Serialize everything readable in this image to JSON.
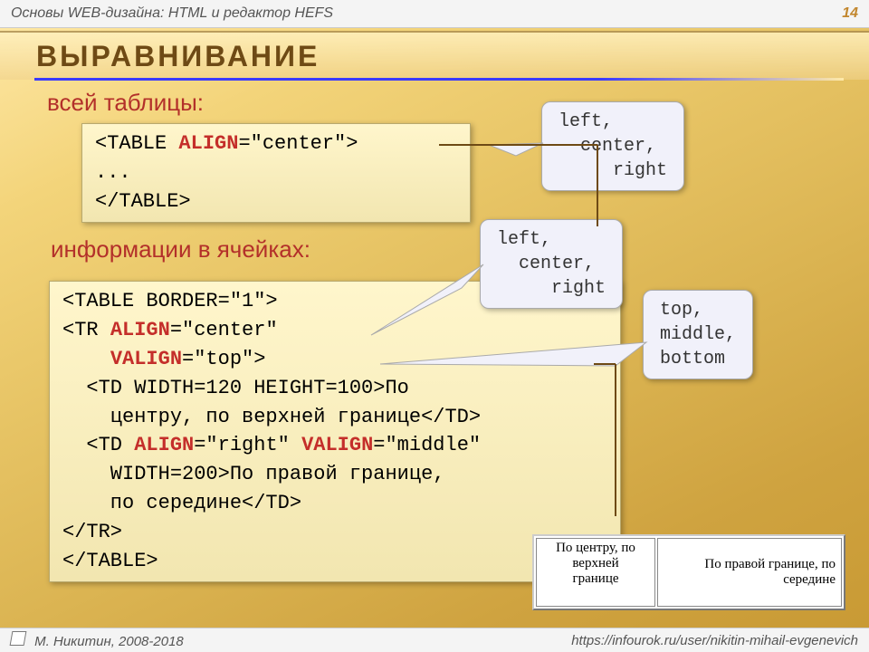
{
  "header": {
    "subject": "Основы WEB-дизайна: HTML и редактор HEFS",
    "page": "14"
  },
  "title": "Выравнивание",
  "sub1": "всей таблицы:",
  "sub2": "информации в ячейках:",
  "code1": {
    "l1a": "<TABLE ",
    "l1b": "ALIGN",
    "l1c": "=\"center\">",
    "l2": "...",
    "l3": "</TABLE>"
  },
  "code2": {
    "l1": "<TABLE BORDER=\"1\">",
    "l2a": "<TR ",
    "l2b": "ALIGN",
    "l2c": "=\"center\"",
    "l3a": "    ",
    "l3b": "VALIGN",
    "l3c": "=\"top\">",
    "l4": "  <TD WIDTH=120 HEIGHT=100>По",
    "l5": "    центру, по верхней границе</TD>",
    "l6a": "  <TD ",
    "l6b": "ALIGN",
    "l6c": "=\"right\" ",
    "l6d": "VALIGN",
    "l6e": "=\"middle\"",
    "l7": "    WIDTH=200>По правой границе,",
    "l8": "    по середине</TD>",
    "l9": "</TR>",
    "l10": "</TABLE>"
  },
  "callout1": "left,\n  center,\n     right",
  "callout2": "left,\n  center,\n     right",
  "callout3": "top,\nmiddle,\nbottom",
  "demo": {
    "c1": "По центру, по\nверхней\nгранице",
    "c2": "По правой границе, по\nсередине"
  },
  "footer": {
    "author": "М. Никитин, 2008-2018",
    "url": "https://infourok.ru/user/nikitin-mihail-evgenevich"
  }
}
